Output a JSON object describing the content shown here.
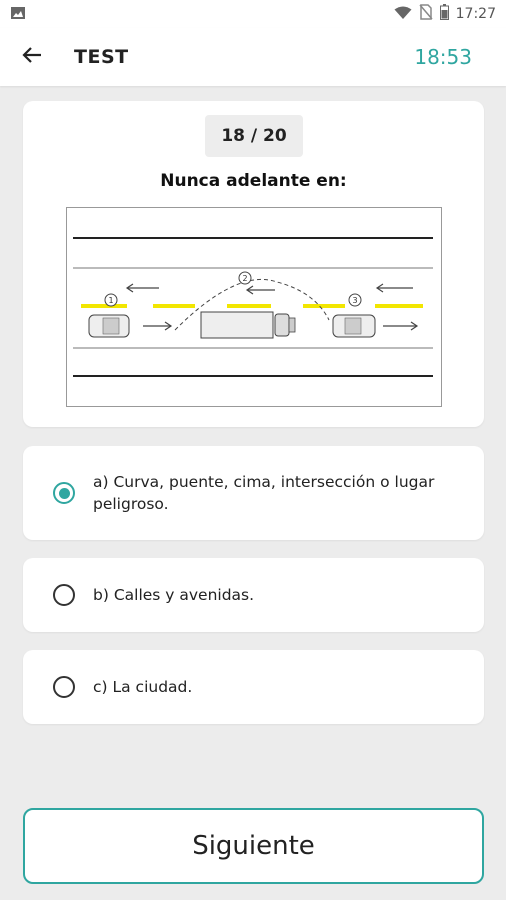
{
  "status_bar": {
    "time": "17:27",
    "icons": [
      "image-icon",
      "wifi-icon",
      "no-sim-icon",
      "battery-icon"
    ]
  },
  "header": {
    "title": "TEST",
    "timer": "18:53",
    "back_icon": "arrow-left-icon"
  },
  "question": {
    "counter": "18 / 20",
    "text": "Nunca adelante en:",
    "diagram_labels": [
      "1",
      "2",
      "3"
    ]
  },
  "options": [
    {
      "label": "a) Curva, puente, cima, intersección o lugar peligroso.",
      "selected": true
    },
    {
      "label": "b) Calles y avenidas.",
      "selected": false
    },
    {
      "label": "c) La ciudad.",
      "selected": false
    }
  ],
  "next_button": {
    "label": "Siguiente"
  },
  "colors": {
    "accent": "#2fa6a0",
    "lane_yellow": "#f2e600",
    "background": "#ececec"
  }
}
